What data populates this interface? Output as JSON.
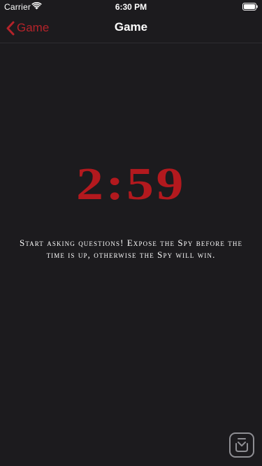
{
  "status_bar": {
    "carrier": "Carrier",
    "time": "6:30 PM",
    "wifi_icon": "wifi-icon",
    "battery_icon": "battery-icon"
  },
  "nav": {
    "back_label": "Game",
    "title": "Game",
    "accent_color": "#b4232a"
  },
  "game": {
    "timer": "2:59",
    "timer_color": "#b3191e",
    "instructions": "Start asking questions! Expose the Spy before the time is up, otherwise the Spy will win."
  },
  "badge": {
    "icon": "app-badge-icon"
  },
  "colors": {
    "background": "#1c1b1e"
  }
}
